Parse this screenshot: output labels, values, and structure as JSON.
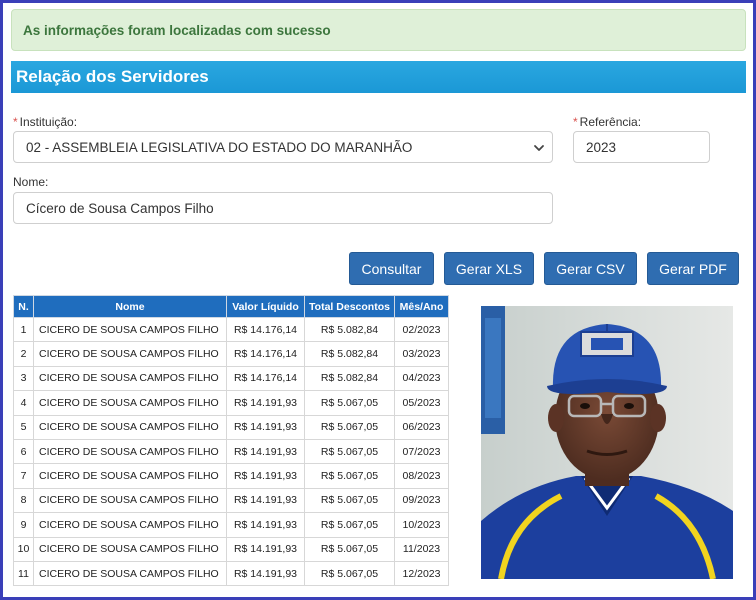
{
  "alert": {
    "message": "As informações foram localizadas com sucesso"
  },
  "section": {
    "title": "Relação dos Servidores"
  },
  "form": {
    "instituicao_label": "Instituição:",
    "instituicao_value": "02 - ASSEMBLEIA LEGISLATIVA DO ESTADO DO MARANHÃO",
    "referencia_label": "Referência:",
    "referencia_value": "2023",
    "nome_label": "Nome:",
    "nome_value": "Cícero de Sousa Campos Filho",
    "required_marker": "*"
  },
  "buttons": {
    "consultar": "Consultar",
    "gerar_xls": "Gerar XLS",
    "gerar_csv": "Gerar CSV",
    "gerar_pdf": "Gerar PDF"
  },
  "table": {
    "headers": [
      "N.",
      "Nome",
      "Valor Líquido",
      "Total Descontos",
      "Mês/Ano"
    ],
    "rows": [
      {
        "n": "1",
        "nome": "CICERO DE SOUSA CAMPOS FILHO",
        "liquido": "R$ 14.176,14",
        "descontos": "R$ 5.082,84",
        "mes": "02/2023"
      },
      {
        "n": "2",
        "nome": "CICERO DE SOUSA CAMPOS FILHO",
        "liquido": "R$ 14.176,14",
        "descontos": "R$ 5.082,84",
        "mes": "03/2023"
      },
      {
        "n": "3",
        "nome": "CICERO DE SOUSA CAMPOS FILHO",
        "liquido": "R$ 14.176,14",
        "descontos": "R$ 5.082,84",
        "mes": "04/2023"
      },
      {
        "n": "4",
        "nome": "CICERO DE SOUSA CAMPOS FILHO",
        "liquido": "R$ 14.191,93",
        "descontos": "R$ 5.067,05",
        "mes": "05/2023"
      },
      {
        "n": "5",
        "nome": "CICERO DE SOUSA CAMPOS FILHO",
        "liquido": "R$ 14.191,93",
        "descontos": "R$ 5.067,05",
        "mes": "06/2023"
      },
      {
        "n": "6",
        "nome": "CICERO DE SOUSA CAMPOS FILHO",
        "liquido": "R$ 14.191,93",
        "descontos": "R$ 5.067,05",
        "mes": "07/2023"
      },
      {
        "n": "7",
        "nome": "CICERO DE SOUSA CAMPOS FILHO",
        "liquido": "R$ 14.191,93",
        "descontos": "R$ 5.067,05",
        "mes": "08/2023"
      },
      {
        "n": "8",
        "nome": "CICERO DE SOUSA CAMPOS FILHO",
        "liquido": "R$ 14.191,93",
        "descontos": "R$ 5.067,05",
        "mes": "09/2023"
      },
      {
        "n": "9",
        "nome": "CICERO DE SOUSA CAMPOS FILHO",
        "liquido": "R$ 14.191,93",
        "descontos": "R$ 5.067,05",
        "mes": "10/2023"
      },
      {
        "n": "10",
        "nome": "CICERO DE SOUSA CAMPOS FILHO",
        "liquido": "R$ 14.191,93",
        "descontos": "R$ 5.067,05",
        "mes": "11/2023"
      },
      {
        "n": "11",
        "nome": "CICERO DE SOUSA CAMPOS FILHO",
        "liquido": "R$ 14.191,93",
        "descontos": "R$ 5.067,05",
        "mes": "12/2023"
      }
    ]
  },
  "icons": {
    "select_arrow": "chevron-down-icon"
  },
  "colors": {
    "alert_bg": "#dff0d8",
    "alert_text": "#3c763d",
    "title_bar": "#1b98d6",
    "button": "#2f6db1",
    "table_header": "#1f6dbe",
    "frame_border": "#3a3fb8"
  }
}
